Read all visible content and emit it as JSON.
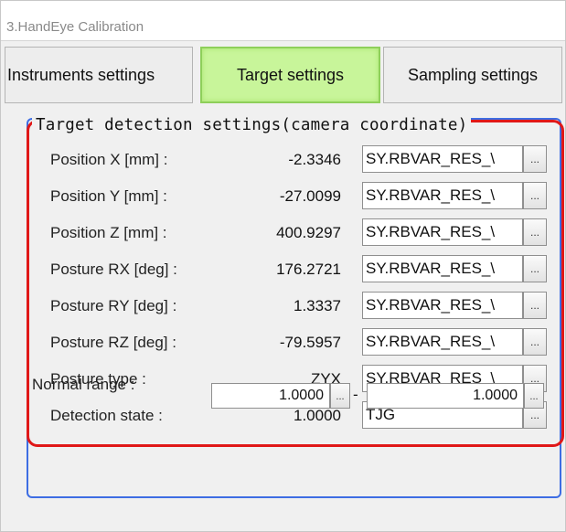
{
  "window": {
    "title": "3.HandEye Calibration"
  },
  "tabs": [
    {
      "label": "Instruments settings",
      "active": false
    },
    {
      "label": "Target settings",
      "active": true
    },
    {
      "label": "Sampling settings",
      "active": false
    }
  ],
  "group": {
    "legend": "Target detection settings(camera coordinate)",
    "rows": [
      {
        "label": "Position X [mm] :",
        "value": "-2.3346",
        "field": "SY.RBVAR_RES_\\",
        "button": "..."
      },
      {
        "label": "Position Y [mm] :",
        "value": "-27.0099",
        "field": "SY.RBVAR_RES_\\",
        "button": "..."
      },
      {
        "label": "Position Z [mm] :",
        "value": "400.9297",
        "field": "SY.RBVAR_RES_\\",
        "button": "..."
      },
      {
        "label": "Posture RX [deg] :",
        "value": "176.2721",
        "field": "SY.RBVAR_RES_\\",
        "button": "..."
      },
      {
        "label": "Posture RY [deg] :",
        "value": "1.3337",
        "field": "SY.RBVAR_RES_\\",
        "button": "..."
      },
      {
        "label": "Posture RZ [deg] :",
        "value": "-79.5957",
        "field": "SY.RBVAR_RES_\\",
        "button": "..."
      },
      {
        "label": "Posture type :",
        "value": "ZYX",
        "field": "SY.RBVAR_RES_\\",
        "button": "..."
      },
      {
        "label": "Detection state :",
        "value": "1.0000",
        "field": "TJG",
        "button": "..."
      }
    ]
  },
  "normal_range": {
    "label": "Normal range :",
    "min": "1.0000",
    "separator": "-",
    "max": "1.0000",
    "button": "..."
  },
  "colors": {
    "active_tab": "#c8f59a",
    "highlight_frame": "#e01818",
    "group_frame": "#3d6de3"
  }
}
